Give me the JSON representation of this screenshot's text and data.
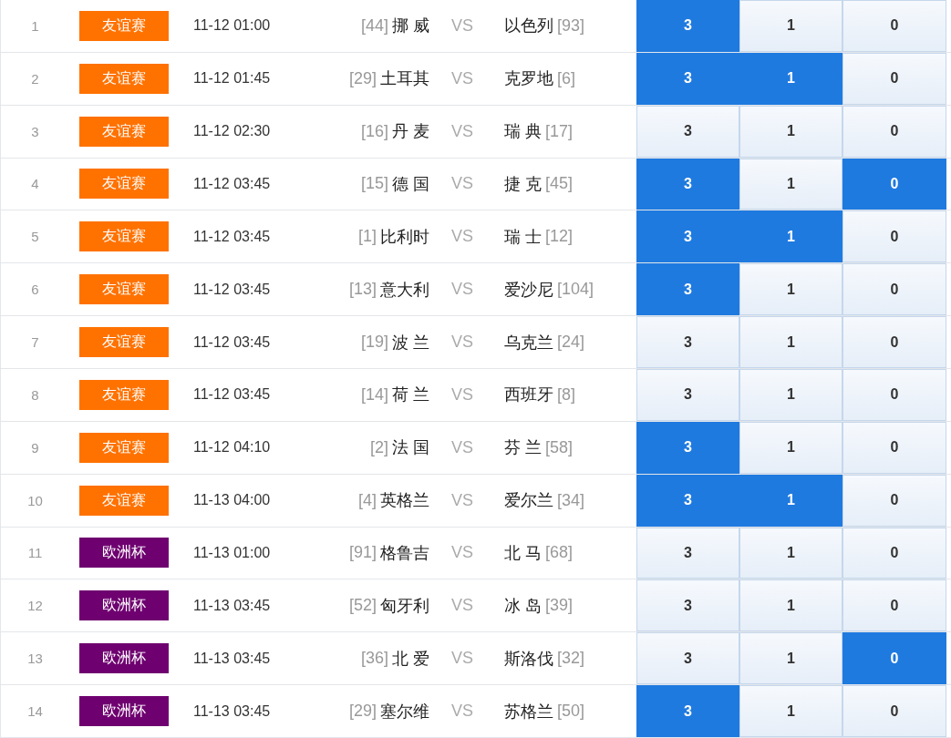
{
  "matches": [
    {
      "no": "1",
      "league": "友谊赛",
      "color": "#ff7200",
      "time": "11-12 01:00",
      "home_rank": "[44]",
      "home": "挪 威",
      "vs": "VS",
      "away": "以色列",
      "away_rank": "[93]",
      "options": [
        {
          "label": "3",
          "selected": true
        },
        {
          "label": "1",
          "selected": false
        },
        {
          "label": "0",
          "selected": false
        }
      ]
    },
    {
      "no": "2",
      "league": "友谊赛",
      "color": "#ff7200",
      "time": "11-12 01:45",
      "home_rank": "[29]",
      "home": "土耳其",
      "vs": "VS",
      "away": "克罗地",
      "away_rank": "[6]",
      "options": [
        {
          "label": "3",
          "selected": true
        },
        {
          "label": "1",
          "selected": true
        },
        {
          "label": "0",
          "selected": false
        }
      ]
    },
    {
      "no": "3",
      "league": "友谊赛",
      "color": "#ff7200",
      "time": "11-12 02:30",
      "home_rank": "[16]",
      "home": "丹 麦",
      "vs": "VS",
      "away": "瑞 典",
      "away_rank": "[17]",
      "options": [
        {
          "label": "3",
          "selected": false
        },
        {
          "label": "1",
          "selected": false
        },
        {
          "label": "0",
          "selected": false
        }
      ]
    },
    {
      "no": "4",
      "league": "友谊赛",
      "color": "#ff7200",
      "time": "11-12 03:45",
      "home_rank": "[15]",
      "home": "德 国",
      "vs": "VS",
      "away": "捷 克",
      "away_rank": "[45]",
      "options": [
        {
          "label": "3",
          "selected": true
        },
        {
          "label": "1",
          "selected": false
        },
        {
          "label": "0",
          "selected": true
        }
      ]
    },
    {
      "no": "5",
      "league": "友谊赛",
      "color": "#ff7200",
      "time": "11-12 03:45",
      "home_rank": "[1]",
      "home": "比利时",
      "vs": "VS",
      "away": "瑞 士",
      "away_rank": "[12]",
      "options": [
        {
          "label": "3",
          "selected": true
        },
        {
          "label": "1",
          "selected": true
        },
        {
          "label": "0",
          "selected": false
        }
      ]
    },
    {
      "no": "6",
      "league": "友谊赛",
      "color": "#ff7200",
      "time": "11-12 03:45",
      "home_rank": "[13]",
      "home": "意大利",
      "vs": "VS",
      "away": "爱沙尼",
      "away_rank": "[104]",
      "options": [
        {
          "label": "3",
          "selected": true
        },
        {
          "label": "1",
          "selected": false
        },
        {
          "label": "0",
          "selected": false
        }
      ]
    },
    {
      "no": "7",
      "league": "友谊赛",
      "color": "#ff7200",
      "time": "11-12 03:45",
      "home_rank": "[19]",
      "home": "波 兰",
      "vs": "VS",
      "away": "乌克兰",
      "away_rank": "[24]",
      "options": [
        {
          "label": "3",
          "selected": false
        },
        {
          "label": "1",
          "selected": false
        },
        {
          "label": "0",
          "selected": false
        }
      ]
    },
    {
      "no": "8",
      "league": "友谊赛",
      "color": "#ff7200",
      "time": "11-12 03:45",
      "home_rank": "[14]",
      "home": "荷 兰",
      "vs": "VS",
      "away": "西班牙",
      "away_rank": "[8]",
      "options": [
        {
          "label": "3",
          "selected": false
        },
        {
          "label": "1",
          "selected": false
        },
        {
          "label": "0",
          "selected": false
        }
      ]
    },
    {
      "no": "9",
      "league": "友谊赛",
      "color": "#ff7200",
      "time": "11-12 04:10",
      "home_rank": "[2]",
      "home": "法 国",
      "vs": "VS",
      "away": "芬 兰",
      "away_rank": "[58]",
      "options": [
        {
          "label": "3",
          "selected": true
        },
        {
          "label": "1",
          "selected": false
        },
        {
          "label": "0",
          "selected": false
        }
      ]
    },
    {
      "no": "10",
      "league": "友谊赛",
      "color": "#ff7200",
      "time": "11-13 04:00",
      "home_rank": "[4]",
      "home": "英格兰",
      "vs": "VS",
      "away": "爱尔兰",
      "away_rank": "[34]",
      "options": [
        {
          "label": "3",
          "selected": true
        },
        {
          "label": "1",
          "selected": true
        },
        {
          "label": "0",
          "selected": false
        }
      ]
    },
    {
      "no": "11",
      "league": "欧洲杯",
      "color": "#6f0070",
      "time": "11-13 01:00",
      "home_rank": "[91]",
      "home": "格鲁吉",
      "vs": "VS",
      "away": "北 马",
      "away_rank": "[68]",
      "options": [
        {
          "label": "3",
          "selected": false
        },
        {
          "label": "1",
          "selected": false
        },
        {
          "label": "0",
          "selected": false
        }
      ]
    },
    {
      "no": "12",
      "league": "欧洲杯",
      "color": "#6f0070",
      "time": "11-13 03:45",
      "home_rank": "[52]",
      "home": "匈牙利",
      "vs": "VS",
      "away": "冰 岛",
      "away_rank": "[39]",
      "options": [
        {
          "label": "3",
          "selected": false
        },
        {
          "label": "1",
          "selected": false
        },
        {
          "label": "0",
          "selected": false
        }
      ]
    },
    {
      "no": "13",
      "league": "欧洲杯",
      "color": "#6f0070",
      "time": "11-13 03:45",
      "home_rank": "[36]",
      "home": "北 爱",
      "vs": "VS",
      "away": "斯洛伐",
      "away_rank": "[32]",
      "options": [
        {
          "label": "3",
          "selected": false
        },
        {
          "label": "1",
          "selected": false
        },
        {
          "label": "0",
          "selected": true
        }
      ]
    },
    {
      "no": "14",
      "league": "欧洲杯",
      "color": "#6f0070",
      "time": "11-13 03:45",
      "home_rank": "[29]",
      "home": "塞尔维",
      "vs": "VS",
      "away": "苏格兰",
      "away_rank": "[50]",
      "options": [
        {
          "label": "3",
          "selected": true
        },
        {
          "label": "1",
          "selected": false
        },
        {
          "label": "0",
          "selected": false
        }
      ]
    }
  ]
}
